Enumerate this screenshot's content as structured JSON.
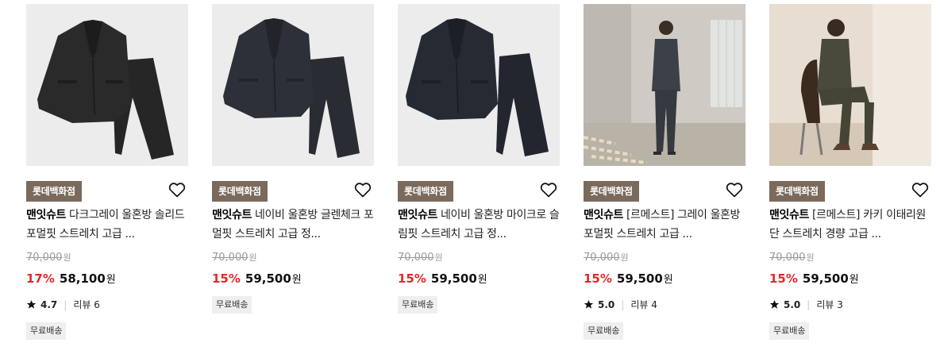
{
  "colors": {
    "badge": "#7b6a5c",
    "discount": "#e8262b",
    "strike": "#999999"
  },
  "products": [
    {
      "store": "롯데백화점",
      "brand": "맨잇슈트",
      "name": "다크그레이 울혼방 솔리드 포멀핏 스트레치 고급 ...",
      "original_price": "70,000",
      "currency": "원",
      "discount": "17%",
      "price": "58,100",
      "rating": "4.7",
      "reviews_label": "리뷰 6",
      "shipping": "무료배송",
      "image": "dark-gray-suit-flat"
    },
    {
      "store": "롯데백화점",
      "brand": "맨잇슈트",
      "name": "네이비 울혼방 글렌체크 포멀핏 스트레치 고급 정...",
      "original_price": "70,000",
      "currency": "원",
      "discount": "15%",
      "price": "59,500",
      "rating": "",
      "reviews_label": "",
      "shipping": "무료배송",
      "image": "navy-check-suit-flat"
    },
    {
      "store": "롯데백화점",
      "brand": "맨잇슈트",
      "name": "네이비 울혼방 마이크로 슬림핏 스트레치 고급 정...",
      "original_price": "70,000",
      "currency": "원",
      "discount": "15%",
      "price": "59,500",
      "rating": "",
      "reviews_label": "",
      "shipping": "무료배송",
      "image": "navy-micro-suit-flat"
    },
    {
      "store": "롯데백화점",
      "brand": "맨잇슈트",
      "name": "[르메스트] 그레이 울혼방 포멀핏 스트레치 고급 ...",
      "original_price": "70,000",
      "currency": "원",
      "discount": "15%",
      "price": "59,500",
      "rating": "5.0",
      "reviews_label": "리뷰 4",
      "shipping": "무료배송",
      "image": "model-standing-gray-suit"
    },
    {
      "store": "롯데백화점",
      "brand": "맨잇슈트",
      "name": "[르메스트] 카키 이태리원단 스트레치 경량 고급 ...",
      "original_price": "70,000",
      "currency": "원",
      "discount": "15%",
      "price": "59,500",
      "rating": "5.0",
      "reviews_label": "리뷰 3",
      "shipping": "무료배송",
      "image": "model-sitting-khaki-suit"
    }
  ]
}
